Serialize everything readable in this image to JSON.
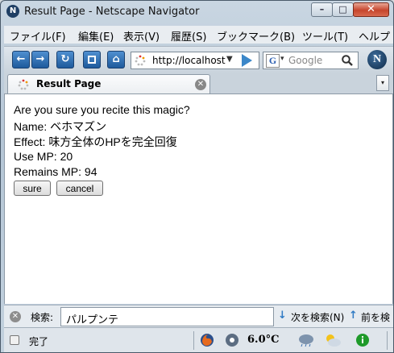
{
  "window": {
    "title": "Result Page - Netscape Navigator",
    "app_icon_letter": "N",
    "minimize_glyph": "–",
    "maximize_glyph": "□",
    "close_glyph": "✕"
  },
  "menubar": {
    "items": [
      "ファイル(F)",
      "編集(E)",
      "表示(V)",
      "履歴(S)",
      "ブックマーク(B)",
      "ツール(T)",
      "ヘルプ"
    ]
  },
  "navbar": {
    "back_icon": "back-arrow-icon",
    "forward_icon": "forward-arrow-icon",
    "reload_icon": "reload-icon",
    "stop_icon": "stop-icon",
    "home_icon": "home-icon",
    "back_glyph": "←",
    "forward_glyph": "→",
    "reload_glyph": "↻",
    "home_glyph": "⌂",
    "url": "http://localhost",
    "url_dropdown_glyph": "▼",
    "search_engine_letter": "G",
    "search_dropdown_glyph": "▾",
    "search_placeholder": "Google",
    "brand_letter": "N"
  },
  "tabs": [
    {
      "label": "Result Page",
      "close_glyph": "✕"
    }
  ],
  "tab_list_glyph": "▾",
  "page": {
    "question": "Are you sure you recite this magic?",
    "name_line": "Name: ベホマズン",
    "effect_line": "Effect: 味方全体のHPを完全回復",
    "use_mp_line": "Use MP: 20",
    "remains_mp_line": "Remains MP: 94",
    "sure_label": "sure",
    "cancel_label": "cancel"
  },
  "findbar": {
    "close_glyph": "✕",
    "label": "検索:",
    "query": "パルプンテ",
    "next_arrow": "↓",
    "next_label": "次を検索(N)",
    "prev_arrow": "↑",
    "prev_label": "前を検"
  },
  "statusbar": {
    "text": "完了",
    "temperature": "6.0°C"
  },
  "colors": {
    "accent_blue": "#2f7bc4",
    "close_red": "#c6452c"
  }
}
